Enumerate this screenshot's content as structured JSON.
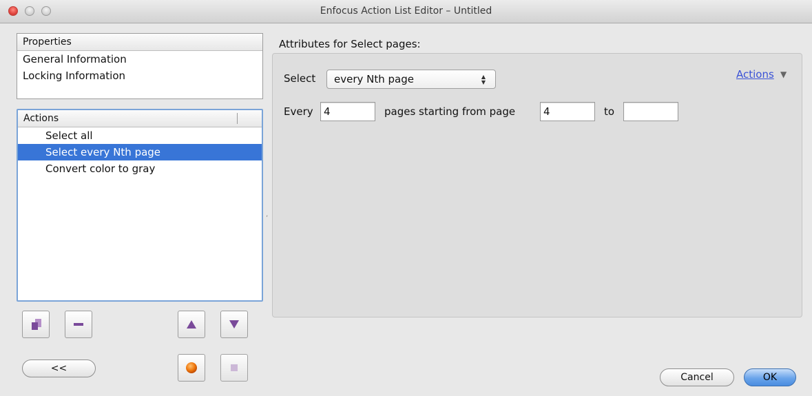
{
  "window": {
    "title": "Enfocus Action List Editor – Untitled"
  },
  "properties": {
    "header": "Properties",
    "items": [
      "General Information",
      "Locking Information"
    ]
  },
  "actions_list": {
    "header": "Actions",
    "items": [
      {
        "label": "Select all",
        "selected": false
      },
      {
        "label": "Select every Nth page",
        "selected": true
      },
      {
        "label": "Convert color to gray",
        "selected": false
      }
    ]
  },
  "buttons": {
    "collapse_label": "<<",
    "cancel_label": "Cancel",
    "ok_label": "OK"
  },
  "attributes": {
    "title": "Attributes for Select pages:",
    "select_label": "Select",
    "select_value": "every Nth page",
    "actions_link": "Actions",
    "every_label": "Every",
    "every_value": "4",
    "starting_label": "pages starting from page",
    "starting_value": "4",
    "to_label": "to",
    "to_value": ""
  },
  "colors": {
    "selection": "#3875d7",
    "accent_purple": "#7a4a9a",
    "record_orange": "#f07a10",
    "link_blue": "#3a52d6"
  },
  "icons": {
    "add": "add-actions-icon",
    "remove": "minus-icon",
    "up": "triangle-up-icon",
    "down": "triangle-down-icon",
    "record": "record-icon",
    "stop": "stop-icon"
  }
}
